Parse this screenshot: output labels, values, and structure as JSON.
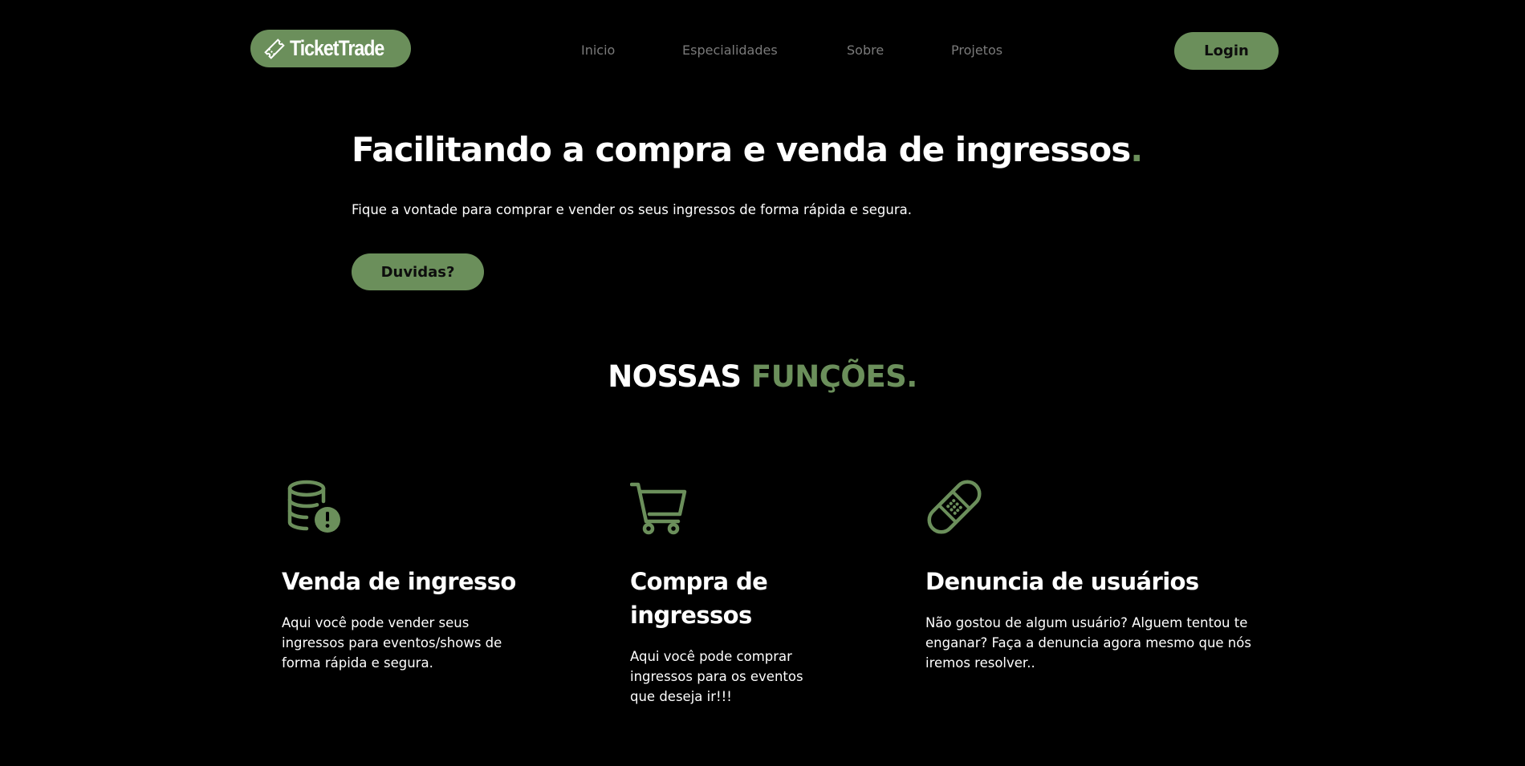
{
  "header": {
    "logo_text": "TicketTrade",
    "nav": [
      "Inicio",
      "Especialidades",
      "Sobre",
      "Projetos"
    ],
    "login_label": "Login"
  },
  "hero": {
    "title": "Facilitando a compra e venda de ingressos",
    "title_dot": ".",
    "subtitle": "Fique a vontade para comprar e vender os seus ingressos de forma rápida e segura.",
    "button_label": "Duvidas?"
  },
  "section": {
    "title_white": "NOSSAS",
    "title_green": "FUNÇÕES."
  },
  "features": [
    {
      "icon": "database-alert-icon",
      "title": "Venda de ingresso",
      "text": "Aqui você pode vender seus ingressos para eventos/shows de forma rápida e segura."
    },
    {
      "icon": "shopping-cart-icon",
      "title": "Compra de ingressos",
      "text": "Aqui você pode comprar ingressos para os eventos que deseja ir!!!"
    },
    {
      "icon": "bandage-icon",
      "title": "Denuncia de usuários",
      "text": "Não gostou de algum usuário? Alguem tentou te enganar? Faça a denuncia agora mesmo que nós iremos resolver.."
    }
  ],
  "colors": {
    "background": "#000000",
    "accent": "#6b8f5b",
    "text": "#ffffff",
    "nav_text": "#7a7a7a"
  }
}
